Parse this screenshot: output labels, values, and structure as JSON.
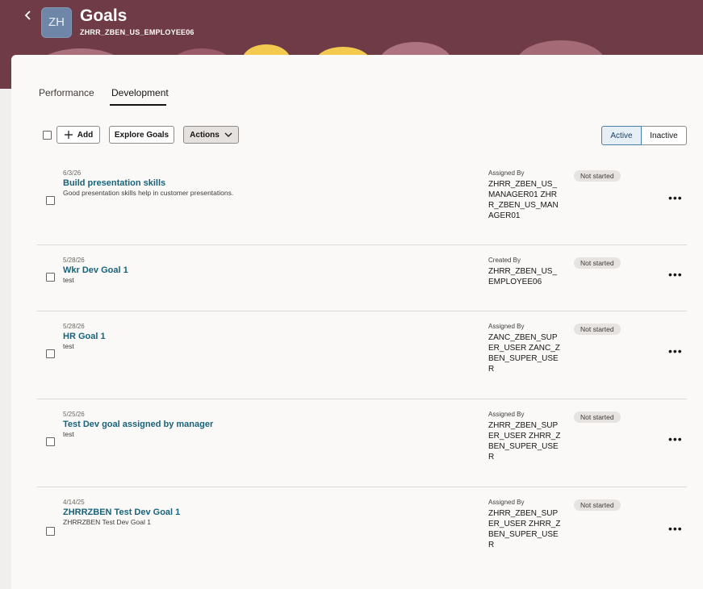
{
  "header": {
    "back_icon": "chevron-left-icon",
    "avatar_initials": "ZH",
    "title": "Goals",
    "subtitle": "ZHRR_ZBEN_US_EMPLOYEE06",
    "colors": {
      "banner": "#6f3b46",
      "accent_yellow": "#f3c94f",
      "accent_pink": "#d99aa6"
    }
  },
  "tabs": [
    {
      "label": "Performance",
      "active": false
    },
    {
      "label": "Development",
      "active": true
    }
  ],
  "toolbar": {
    "add_label": "Add",
    "add_icon": "plus-icon",
    "explore_label": "Explore Goals",
    "actions_label": "Actions",
    "actions_icon": "chevron-down-icon",
    "filter_active_label": "Active",
    "filter_inactive_label": "Inactive"
  },
  "goals": [
    {
      "date": "6/3/26",
      "title": "Build presentation skills",
      "description": "Good presentation skills help in customer presentations.",
      "assigned_label": "Assigned By",
      "assigned_value": "ZHRR_ZBEN_US_MANAGER01 ZHRR_ZBEN_US_MANAGER01",
      "status": "Not started"
    },
    {
      "date": "5/28/26",
      "title": "Wkr Dev Goal 1",
      "description": "test",
      "assigned_label": "Created By",
      "assigned_value": "ZHRR_ZBEN_US_EMPLOYEE06",
      "status": "Not started"
    },
    {
      "date": "5/28/26",
      "title": "HR Goal 1",
      "description": "test",
      "assigned_label": "Assigned By",
      "assigned_value": "ZANC_ZBEN_SUPER_USER ZANC_ZBEN_SUPER_USER",
      "status": "Not started"
    },
    {
      "date": "5/25/26",
      "title": "Test Dev goal assigned by manager",
      "description": "test",
      "assigned_label": "Assigned By",
      "assigned_value": "ZHRR_ZBEN_SUPER_USER ZHRR_ZBEN_SUPER_USER",
      "status": "Not started"
    },
    {
      "date": "4/14/25",
      "title": "ZHRRZBEN Test Dev Goal 1",
      "description": "ZHRRZBEN Test Dev Goal 1",
      "assigned_label": "Assigned By",
      "assigned_value": "ZHRR_ZBEN_SUPER_USER ZHRR_ZBEN_SUPER_USER",
      "status": "Not started"
    }
  ],
  "row_more_label": "•••"
}
